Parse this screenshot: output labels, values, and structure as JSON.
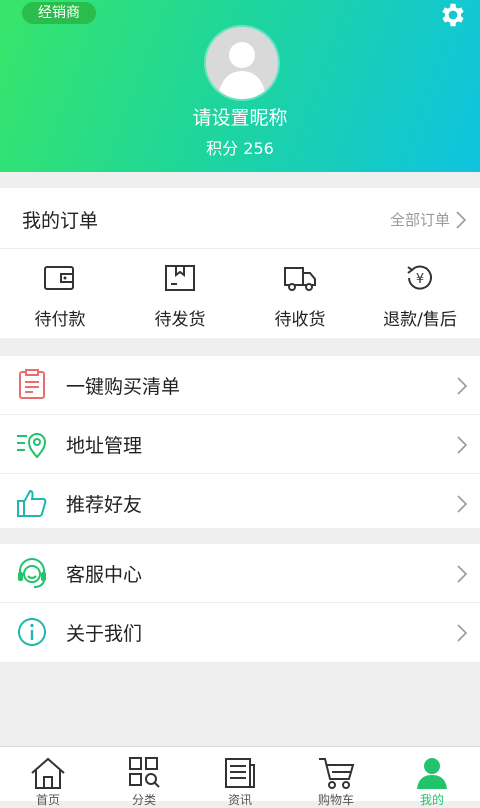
{
  "header": {
    "badge": "经销商",
    "nickname": "请设置昵称",
    "points": "积分 256",
    "gradient_colors": [
      "#38e56a",
      "#0fc3e0"
    ]
  },
  "orders": {
    "title": "我的订单",
    "all_link": "全部订单",
    "items": [
      {
        "label": "待付款",
        "icon": "wallet-icon"
      },
      {
        "label": "待发货",
        "icon": "package-icon"
      },
      {
        "label": "待收货",
        "icon": "truck-icon"
      },
      {
        "label": "退款/售后",
        "icon": "refund-yen-icon"
      }
    ]
  },
  "menu1": [
    {
      "label": "一键购买清单",
      "icon": "clipboard-list-icon",
      "color": "#ee6b6b"
    },
    {
      "label": "地址管理",
      "icon": "address-pin-icon",
      "color": "#22c36b"
    },
    {
      "label": "推荐好友",
      "icon": "thumbs-up-icon",
      "color": "#1fb8b0"
    }
  ],
  "menu2": [
    {
      "label": "客服中心",
      "icon": "headset-icon",
      "color": "#22c36b"
    },
    {
      "label": "关于我们",
      "icon": "info-icon",
      "color": "#1fb8b0"
    }
  ],
  "tabbar": {
    "active_color": "#22c36b",
    "items": [
      {
        "label": "首页",
        "icon": "home-icon"
      },
      {
        "label": "分类",
        "icon": "category-icon"
      },
      {
        "label": "资讯",
        "icon": "news-icon"
      },
      {
        "label": "购物车",
        "icon": "cart-icon"
      },
      {
        "label": "我的",
        "icon": "profile-icon"
      }
    ]
  }
}
